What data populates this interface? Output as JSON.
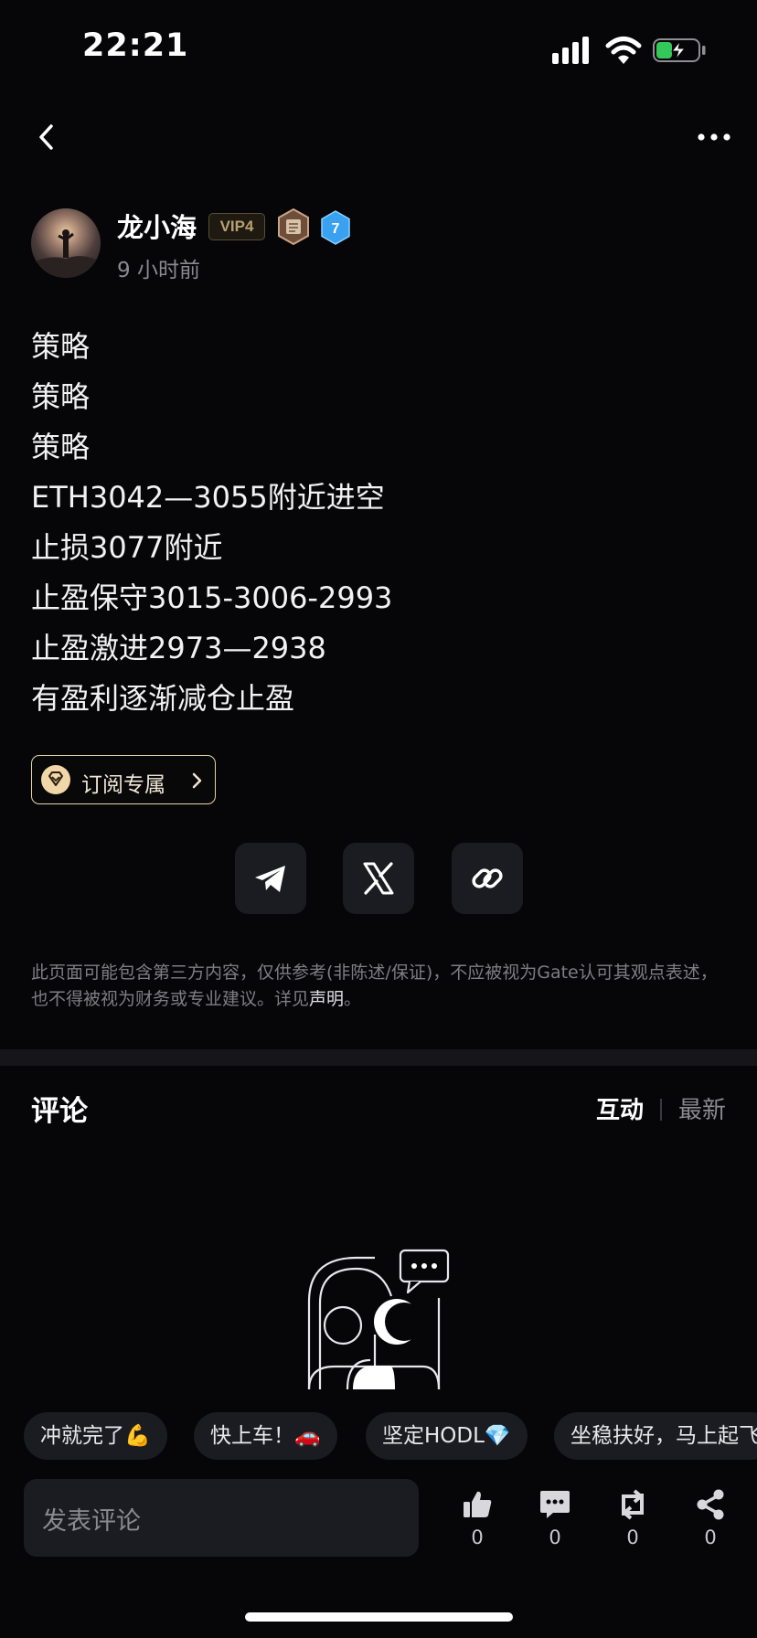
{
  "status_bar": {
    "time": "22:21"
  },
  "post": {
    "author": "龙小海",
    "vip": "VIP4",
    "level_badge": "7",
    "time_ago": "9 小时前",
    "lines": [
      "策略",
      "策略",
      "策略",
      "ETH3042—3055附近进空",
      "止损3077附近",
      "止盈保守3015-3006-2993",
      "止盈激进2973—2938",
      "有盈利逐渐减仓止盈"
    ],
    "subscribe_label": "订阅专属"
  },
  "disclaimer": {
    "text": "此页面可能包含第三方内容，仅供参考(非陈述/保证)，不应被视为Gate认可其观点表述，也不得被视为财务或专业建议。详见",
    "link": "声明",
    "end": "。"
  },
  "comments": {
    "title": "评论",
    "sort_active": "互动",
    "sort_other": "最新"
  },
  "quick_replies": [
    "冲就完了💪",
    "快上车！🚗",
    "坚定HODL💎",
    "坐稳扶好，马上起飞"
  ],
  "composer": {
    "placeholder": "发表评论",
    "likes": "0",
    "comments": "0",
    "reposts": "0",
    "shares": "0"
  },
  "colors": {
    "background": "#060609",
    "accent_gold": "#f1d7a8",
    "battery_green": "#34c759",
    "level_blue": "#3aa0f0"
  }
}
